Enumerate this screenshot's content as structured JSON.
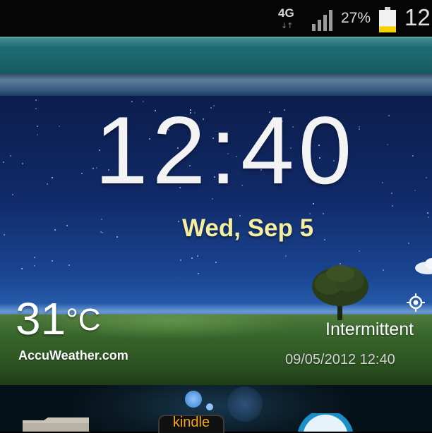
{
  "status_bar": {
    "network": "4G",
    "signal_icon": "signal-bars-icon",
    "battery_percent": "27%",
    "battery_level": 0.27,
    "battery_color": "#f5d300",
    "time": "12"
  },
  "clock_widget": {
    "time": "12:40",
    "date": "Wed, Sep 5"
  },
  "weather": {
    "temperature": "31",
    "unit": "°C",
    "provider": "AccuWeather.com",
    "condition": "Intermittent",
    "updated": "09/05/2012 12:40",
    "location_icon": "locate-icon"
  },
  "dock": {
    "apps": [
      {
        "icon": "folder-icon"
      },
      {
        "label": "kindle",
        "icon": "kindle-icon"
      },
      {
        "icon": "browser-icon"
      }
    ]
  },
  "colors": {
    "date_text": "#f3eea0",
    "teal_band": "#1f6d73",
    "kindle_orange": "#f2a321"
  }
}
